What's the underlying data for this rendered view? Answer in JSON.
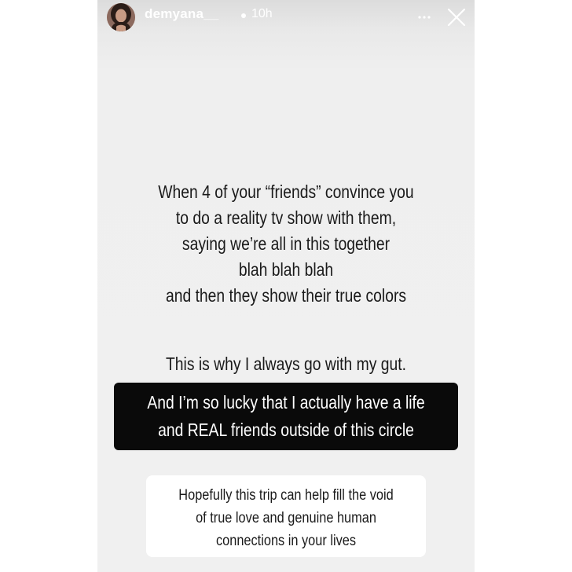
{
  "header": {
    "username": "demyana__",
    "time": "10h",
    "more_icon": "more-horizontal-icon",
    "close_icon": "close-icon"
  },
  "story": {
    "main_lines": [
      "When 4 of your “friends” convince you",
      "to do a reality tv show with them,",
      "saying we’re all in this together",
      "blah blah blah",
      "and then they show their true colors"
    ],
    "gut_line": "This is why I always go with my gut.",
    "highlight_lines": [
      "And I’m so lucky that I actually have a life",
      "and REAL friends outside of this circle"
    ],
    "box_lines": [
      "Hopefully this trip can help fill the void",
      "of true love and genuine human",
      "connections in your lives"
    ]
  },
  "colors": {
    "story_background": "#efefef",
    "highlight_background": "#0a0a0a",
    "box_background": "#ffffff",
    "text": "#1a1a1a"
  }
}
